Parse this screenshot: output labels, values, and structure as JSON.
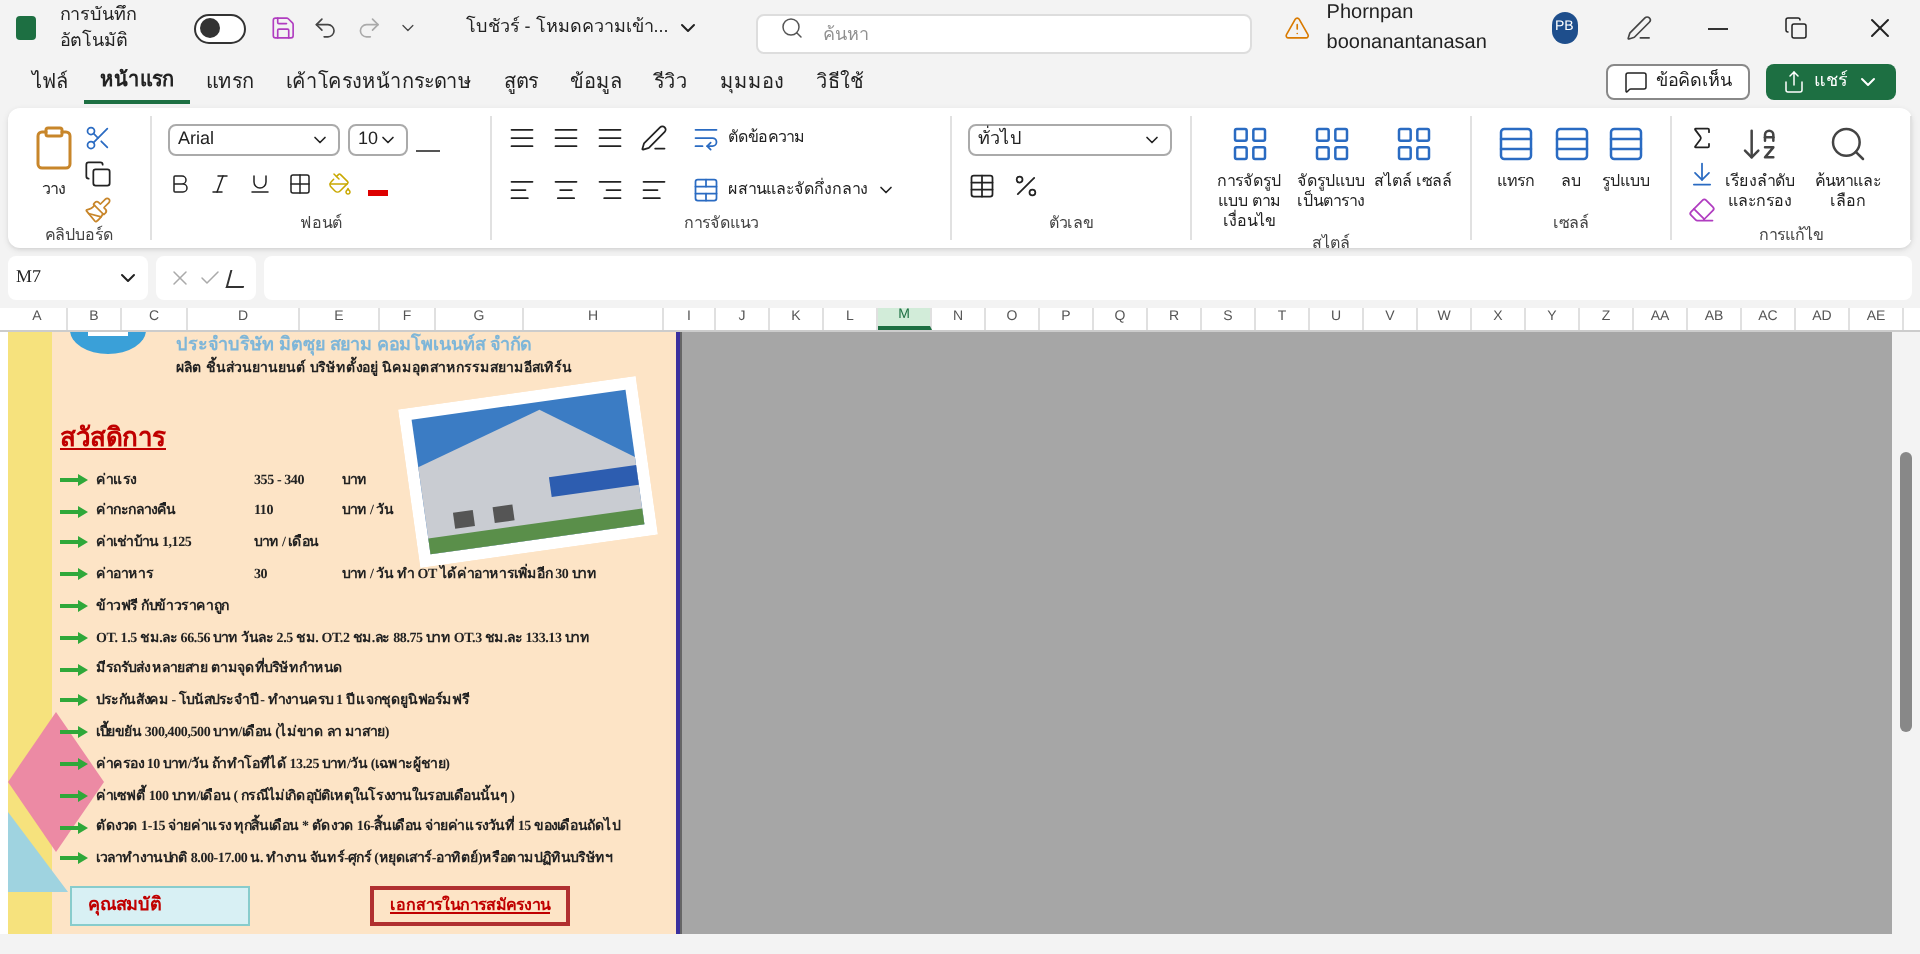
{
  "titlebar": {
    "autosave_label": "การบันทึกอัตโนมัติ",
    "autosave_on": false,
    "filename": "โบชัวร์ - โหมดความเข้า...",
    "search_placeholder": "ค้นหา",
    "user": "Phornpan boonanantanasan",
    "avatar": "PB"
  },
  "tabs": [
    {
      "label": "ไฟล์",
      "selected": false
    },
    {
      "label": "หน้าแรก",
      "selected": true
    },
    {
      "label": "แทรก",
      "selected": false
    },
    {
      "label": "เค้าโครงหน้ากระดาษ",
      "selected": false
    },
    {
      "label": "สูตร",
      "selected": false
    },
    {
      "label": "ข้อมูล",
      "selected": false
    },
    {
      "label": "รีวิว",
      "selected": false
    },
    {
      "label": "มุมมอง",
      "selected": false
    },
    {
      "label": "วิธีใช้",
      "selected": false
    }
  ],
  "comments_button": "ข้อคิดเห็น",
  "share_button": "แชร์",
  "ribbon": {
    "paste": "วาง",
    "clipboard": "คลิปบอร์ด",
    "font_name": "Arial",
    "font_size": "10",
    "font": "ฟอนต์",
    "wrap": "ตัดข้อความ",
    "merge": "ผสานและจัดกึ่งกลาง",
    "alignment": "การจัดแนว",
    "number_format": "ทั่วไป",
    "number": "ตัวเลข",
    "styles_buttons": [
      "การจัดรูปแบบ ตามเงื่อนไข",
      "จัดรูปแบบ เป็นตาราง",
      "สไตล์ เซลล์"
    ],
    "styles": "สไตล์",
    "cells_buttons": [
      "แทรก",
      "ลบ",
      "รูปแบบ"
    ],
    "cells": "เซลล์",
    "edit_buttons": [
      "เรียงลำดับ และกรอง",
      "ค้นหาและ เลือก"
    ],
    "editing": "การแก้ไข"
  },
  "formula_bar": {
    "name_box": "M7"
  },
  "columns": [
    {
      "label": "A",
      "selected": false
    },
    {
      "label": "B",
      "selected": false
    },
    {
      "label": "C",
      "selected": false
    },
    {
      "label": "D",
      "selected": false
    },
    {
      "label": "E",
      "selected": false
    },
    {
      "label": "F",
      "selected": false
    },
    {
      "label": "G",
      "selected": false
    },
    {
      "label": "H",
      "selected": false
    },
    {
      "label": "I",
      "selected": false
    },
    {
      "label": "J",
      "selected": false
    },
    {
      "label": "K",
      "selected": false
    },
    {
      "label": "L",
      "selected": false
    },
    {
      "label": "M",
      "selected": true
    },
    {
      "label": "N",
      "selected": false
    },
    {
      "label": "O",
      "selected": false
    },
    {
      "label": "P",
      "selected": false
    },
    {
      "label": "Q",
      "selected": false
    },
    {
      "label": "R",
      "selected": false
    },
    {
      "label": "S",
      "selected": false
    },
    {
      "label": "T",
      "selected": false
    },
    {
      "label": "U",
      "selected": false
    },
    {
      "label": "V",
      "selected": false
    },
    {
      "label": "W",
      "selected": false
    },
    {
      "label": "X",
      "selected": false
    },
    {
      "label": "Y",
      "selected": false
    },
    {
      "label": "Z",
      "selected": false
    },
    {
      "label": "AA",
      "selected": false
    },
    {
      "label": "AB",
      "selected": false
    },
    {
      "label": "AC",
      "selected": false
    },
    {
      "label": "AD",
      "selected": false
    },
    {
      "label": "AE",
      "selected": false
    }
  ],
  "poster": {
    "title": "ประจำบริษัท มิตซุย สยาม คอมโพเนนท์ส จำกัด",
    "subtitle": "ผลิต ชิ้นส่วนยานยนต์ บริษัทตั้งอยู่ นิคมอุตสาหกรรมสยามอีสเทิร์น",
    "heading": "สวัสดิการ",
    "items": [
      {
        "cells": [
          "ค่าแรง",
          "355 - 340",
          "บาท"
        ]
      },
      {
        "cells": [
          "ค่ากะกลางคืน",
          "110",
          "บาท / วัน"
        ]
      },
      {
        "cells": [
          "ค่าเช่าบ้าน  1,125",
          "บาท / เดือน"
        ]
      },
      {
        "cells": [
          "ค่าอาหาร",
          "30",
          "บาท / วัน  ทำ OT ได้ค่าอาหารเพิ่มอีก 30 บาท"
        ]
      },
      {
        "cells": [
          "ข้าวฟรี  กับข้าวราคาถูก"
        ]
      },
      {
        "cells": [
          "OT. 1.5  ชม.ละ  66.56 บาท  วันละ 2.5 ชม.  OT.2 ชม.ละ   88.75  บาท  OT.3 ชม.ละ 133.13 บาท"
        ]
      },
      {
        "cells": [
          "มีรถรับส่ง  หลายสาย  ตามจุดที่บริษัทกำหนด"
        ]
      },
      {
        "cells": [
          "ประกันสังคม   - โบนัสประจำปี  - ทำงานครบ 1 ปี แจกชุดยูนิฟอร์มฟรี"
        ]
      },
      {
        "cells": [
          "เบี้ยขยัน  300,400,500  บาท/เดือน  (ไม่ขาด ลา มาสาย)"
        ]
      },
      {
        "cells": [
          "ค่าครอง  10  บาท/วัน ถ้าทำโอทีได้ 13.25 บาท/วัน (เฉพาะผู้ชาย)"
        ]
      },
      {
        "cells": [
          "ค่าเซฟตี้ 100  บาท/เดือน  ( กรณีไม่เกิดอุบัติเหตุในโรงงานในรอบเดือนนั้นๆ )"
        ]
      },
      {
        "cells": [
          "ตัดงวด 1-15 จ่ายค่าแรง ทุกสิ้นเดือน * ตัดงวด 16-สิ้นเดือน จ่ายค่าแรงวันที่  15 ของเดือนถัดไป"
        ]
      },
      {
        "cells": [
          "เวลาทำงานปกติ  8.00-17.00 น. ทำงาน จันทร์-ศุกร์ (หยุดเสาร์-อาทิตย์)หรือตามปฏิทินบริษัทฯ"
        ]
      }
    ],
    "box_left": "คุณสมบัติ",
    "box_right": "เอกสารในการสมัครงาน"
  }
}
